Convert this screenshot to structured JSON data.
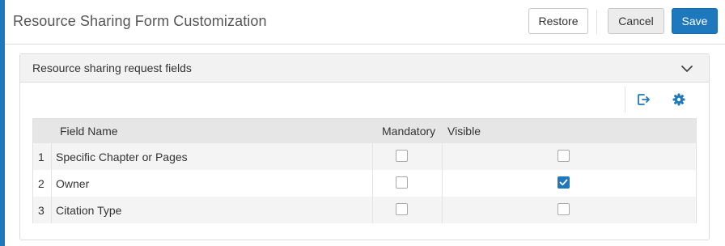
{
  "header": {
    "title": "Resource Sharing Form Customization",
    "restore_label": "Restore",
    "cancel_label": "Cancel",
    "save_label": "Save"
  },
  "panel": {
    "title": "Resource sharing request fields",
    "toolbar_icons": [
      "export-icon",
      "gear-icon"
    ]
  },
  "table": {
    "columns": [
      "",
      "Field Name",
      "Mandatory",
      "Visible"
    ],
    "rows": [
      {
        "index": "1",
        "name": "Specific Chapter or Pages",
        "mandatory": false,
        "visible": false
      },
      {
        "index": "2",
        "name": "Owner",
        "mandatory": false,
        "visible": true
      },
      {
        "index": "3",
        "name": "Citation Type",
        "mandatory": false,
        "visible": false
      }
    ]
  },
  "colors": {
    "accent": "#1e78bd",
    "header_bg": "#e6e6e6",
    "row_alt_bg": "#f4f4f4"
  }
}
